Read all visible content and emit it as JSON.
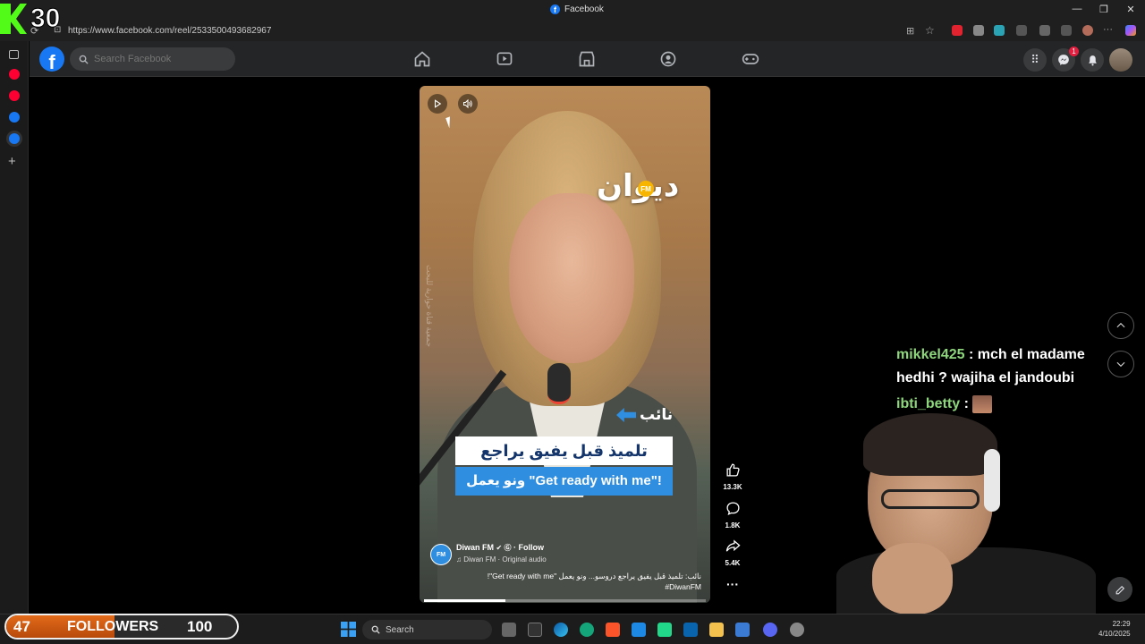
{
  "window": {
    "title": "Facebook"
  },
  "browser": {
    "url": "https://www.facebook.com/reel/2533500493682967"
  },
  "stream_overlay": {
    "count": "30"
  },
  "header": {
    "logo": "f",
    "search_placeholder": "Search Facebook"
  },
  "header_icons": [
    "home-icon",
    "video-icon",
    "marketplace-icon",
    "groups-icon",
    "gaming-icon"
  ],
  "notifications": {
    "messenger_badge": "1"
  },
  "reel": {
    "station_logo": "ديوان",
    "station_fm": "FM",
    "watermark": "جمعية قناة حوارية للبحث",
    "tag": "نائب",
    "caption_line1": "تلميذ قبل يفيق يراجع دروسو",
    "caption_line2": "ونو يعمل \"Get ready with me\"!",
    "channel_name": "Diwan FM",
    "follow_label": "· Follow",
    "audio": "Diwan FM · Original audio",
    "description": "نائب: تلميذ قبل يفيق يراجع دروسو... ونو يعمل \"Get ready with me\"!",
    "hashtag": "#DiwanFM",
    "progress": 0.29
  },
  "actions": {
    "likes": "13.3K",
    "comments": "1.8K",
    "shares": "5.4K"
  },
  "chat": [
    {
      "user": "mikkel425",
      "message": "mch el madame hedhi ? wajiha el jandoubi"
    },
    {
      "user": "ibti_betty",
      "message": ""
    }
  ],
  "followers_bar": {
    "current": "47",
    "label": "FOLLOWERS",
    "goal": "100",
    "fraction": 0.47
  },
  "taskbar": {
    "search_label": "Search",
    "time": "22:29",
    "date": "4/10/2025"
  }
}
